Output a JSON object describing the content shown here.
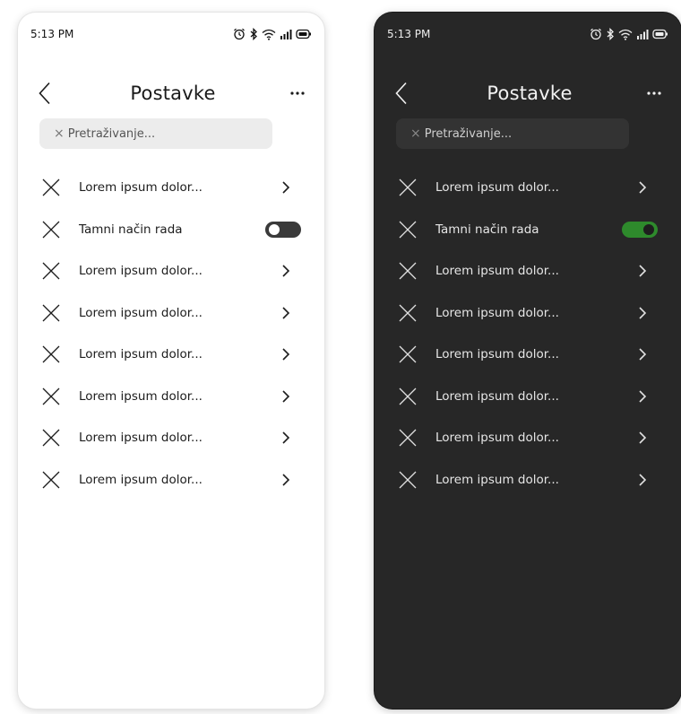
{
  "colors": {
    "light_bg": "#ffffff",
    "dark_bg": "#272727",
    "toggle_off": "#3a3a3a",
    "toggle_on": "#2e8a2c"
  },
  "light": {
    "status_time": "5:13 PM",
    "title": "Postavke",
    "search_placeholder": "Pretraživanje...",
    "items": [
      {
        "label": "Lorem ipsum dolor...",
        "control": "chevron"
      },
      {
        "label": "Tamni način rada",
        "control": "toggle",
        "toggle_on": false
      },
      {
        "label": "Lorem ipsum dolor...",
        "control": "chevron"
      },
      {
        "label": "Lorem ipsum dolor...",
        "control": "chevron"
      },
      {
        "label": "Lorem ipsum dolor...",
        "control": "chevron"
      },
      {
        "label": "Lorem ipsum dolor...",
        "control": "chevron"
      },
      {
        "label": "Lorem ipsum dolor...",
        "control": "chevron"
      },
      {
        "label": "Lorem ipsum dolor...",
        "control": "chevron"
      }
    ]
  },
  "dark": {
    "status_time": "5:13 PM",
    "title": "Postavke",
    "search_placeholder": "Pretraživanje...",
    "items": [
      {
        "label": "Lorem ipsum dolor...",
        "control": "chevron"
      },
      {
        "label": "Tamni način rada",
        "control": "toggle",
        "toggle_on": true
      },
      {
        "label": "Lorem ipsum dolor...",
        "control": "chevron"
      },
      {
        "label": "Lorem ipsum dolor...",
        "control": "chevron"
      },
      {
        "label": "Lorem ipsum dolor...",
        "control": "chevron"
      },
      {
        "label": "Lorem ipsum dolor...",
        "control": "chevron"
      },
      {
        "label": "Lorem ipsum dolor...",
        "control": "chevron"
      },
      {
        "label": "Lorem ipsum dolor...",
        "control": "chevron"
      }
    ]
  },
  "icons": {
    "status": [
      "alarm-icon",
      "bluetooth-icon",
      "wifi-icon",
      "signal-icon",
      "battery-icon"
    ],
    "back": "chevron-left-icon",
    "more": "more-horizontal-icon",
    "search_clear": "close-icon",
    "row": "close-icon",
    "row_trailing": "chevron-right-icon"
  }
}
